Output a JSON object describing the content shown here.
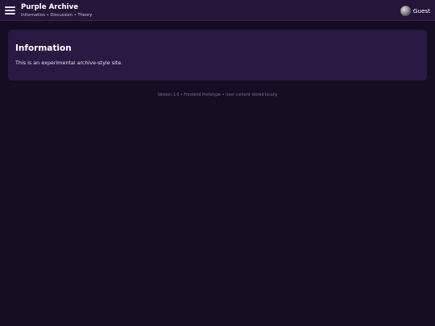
{
  "header": {
    "menu_icon": "hamburger-menu-icon",
    "title": "Purple Archive",
    "subtitle": "Information • Discussion • Theory",
    "user": {
      "avatar_icon": "user-avatar",
      "label": "Guest"
    }
  },
  "main": {
    "card": {
      "title": "Information",
      "body": "This is an experimental archive-style site."
    }
  },
  "footer": {
    "text": "Version 1.0 • Frontend Prototype • User content stored locally"
  },
  "colors": {
    "background": "#150d22",
    "topbar": "#251539",
    "card": "#2a1943",
    "footer_text": "#7d7390"
  }
}
